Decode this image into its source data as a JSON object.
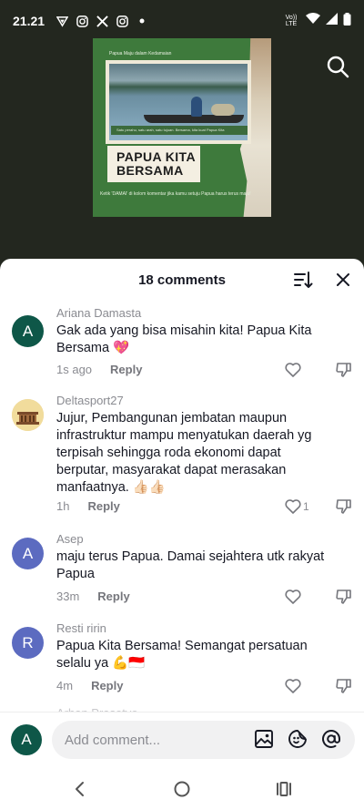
{
  "status": {
    "time": "21.21",
    "apps": [
      "vpn-icon",
      "instagram-icon",
      "x-icon",
      "instagram-icon",
      "dot-icon"
    ],
    "network": "Vo)) LTE"
  },
  "video": {
    "top_text": "Papua Maju dalam Kedamaian",
    "photo_caption": "Satu perahu, satu arah, satu tujuan. Bersama, kita kuat Papua Kita",
    "headline_line1": "PAPUA KITA",
    "headline_line2": "BERSAMA",
    "bottom_text": "Ketik 'DAMAI' di kolom komentar jika kamu setuju Papua harus terus maju!"
  },
  "sheet": {
    "title": "18 comments"
  },
  "comments": [
    {
      "avatar_letter": "A",
      "avatar_color": "#0e5748",
      "name": "Ariana Damasta",
      "text": "Gak ada yang bisa misahin kita! Papua Kita Bersama 💖",
      "time": "1s ago",
      "reply": "Reply",
      "likes": ""
    },
    {
      "avatar_letter": "",
      "avatar_color": "#d9b86a",
      "name": "Deltasport27",
      "text": "Jujur, Pembangunan jembatan maupun infrastruktur mampu menyatukan daerah yg terpisah sehingga roda ekonomi dapat berputar, masyarakat dapat merasakan manfaatnya. 👍🏻👍🏻",
      "time": "1h",
      "reply": "Reply",
      "likes": "1"
    },
    {
      "avatar_letter": "A",
      "avatar_color": "#5c6bc0",
      "name": "Asep",
      "text": "maju terus Papua. Damai sejahtera utk rakyat Papua",
      "time": "33m",
      "reply": "Reply",
      "likes": ""
    },
    {
      "avatar_letter": "R",
      "avatar_color": "#5c6bc0",
      "name": "Resti ririn",
      "text": "Papua Kita Bersama! Semangat persatuan selalu ya 💪🇮🇩",
      "time": "4m",
      "reply": "Reply",
      "likes": ""
    }
  ],
  "peek_name": "Arhan Prasetyo",
  "input": {
    "avatar_letter": "A",
    "placeholder": "Add comment..."
  }
}
